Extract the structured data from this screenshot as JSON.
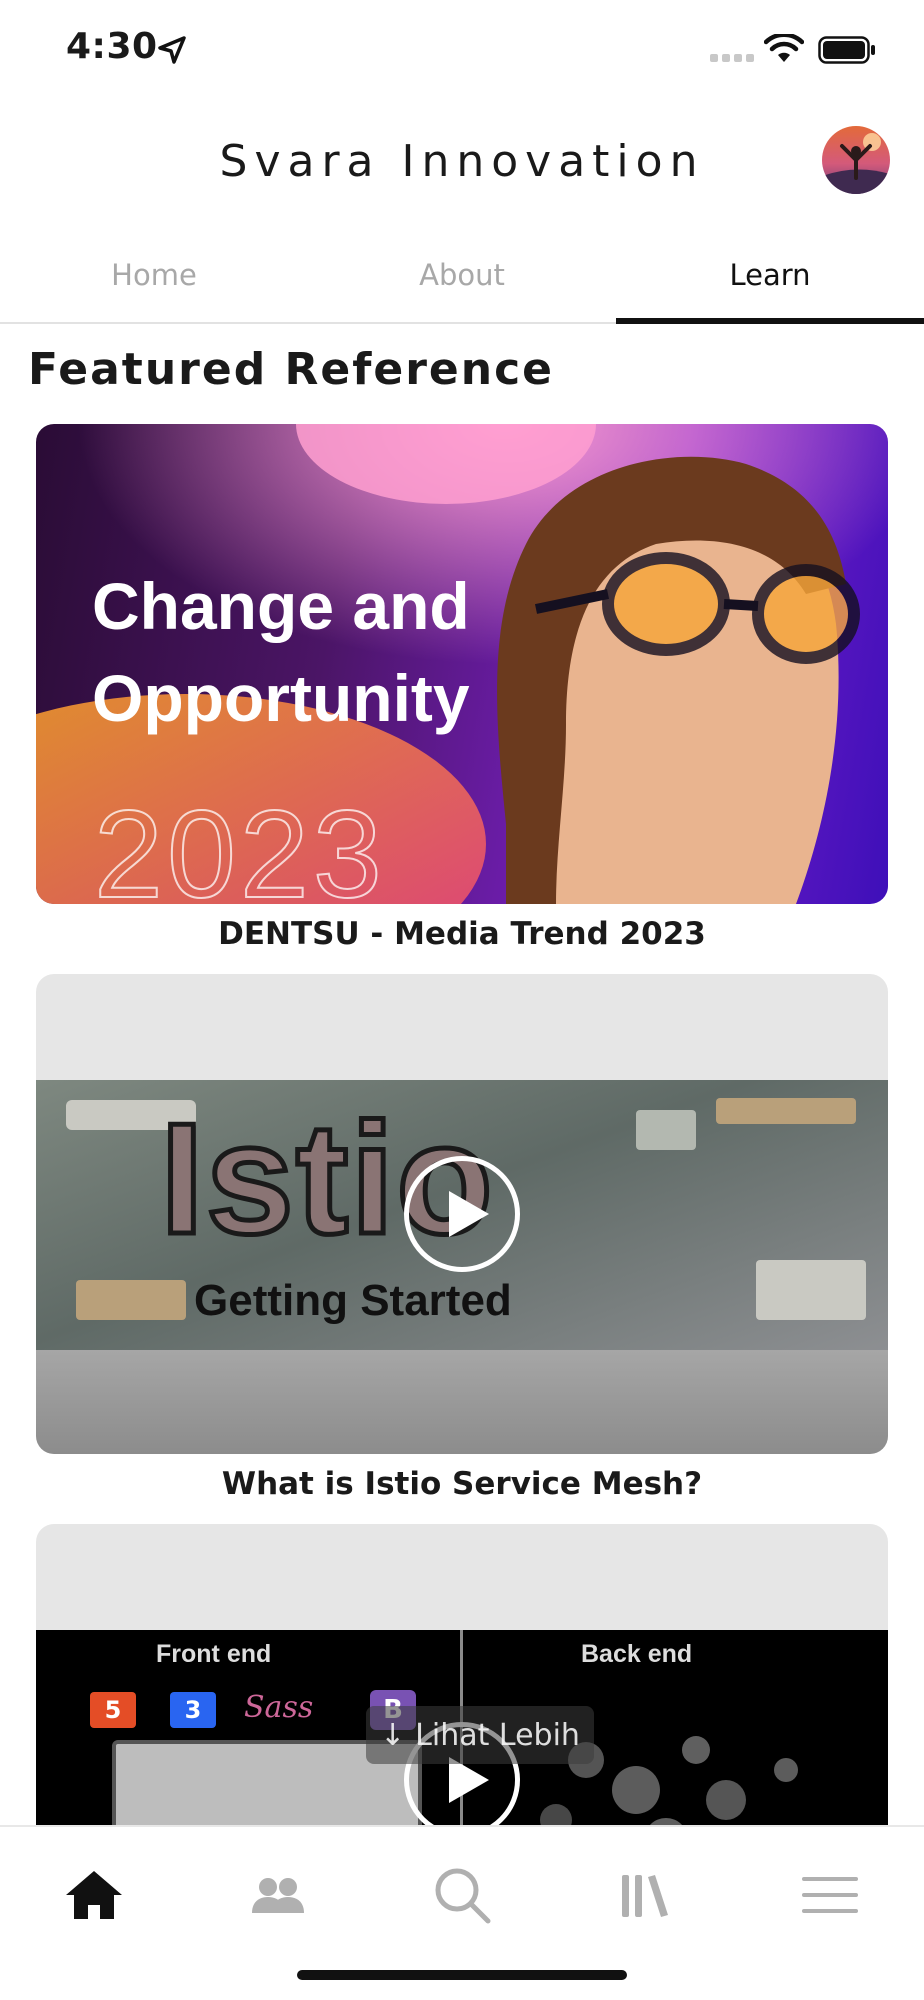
{
  "status_bar": {
    "time": "4:30"
  },
  "header": {
    "title": "Svara Innovation"
  },
  "tabs": [
    {
      "label": "Home",
      "active": false
    },
    {
      "label": "About",
      "active": false
    },
    {
      "label": "Learn",
      "active": true
    }
  ],
  "section": {
    "title": "Featured Reference"
  },
  "cards": [
    {
      "caption": "DENTSU - Media Trend 2023",
      "thumbnail_text": [
        "Change and",
        "Opportunity",
        "2023"
      ],
      "type": "image"
    },
    {
      "caption": "What is Istio Service Mesh?",
      "thumbnail_text": [
        "Istio",
        "Getting Started"
      ],
      "type": "video"
    },
    {
      "caption": "",
      "thumbnail_text": [
        "Front end",
        "Back end",
        "5",
        "3",
        "Sass",
        "B"
      ],
      "type": "video"
    }
  ],
  "see_more": {
    "label": "Lihat Lebih"
  },
  "bottom_nav": [
    {
      "icon": "home-icon",
      "active": true
    },
    {
      "icon": "community-icon",
      "active": false
    },
    {
      "icon": "search-icon",
      "active": false
    },
    {
      "icon": "library-icon",
      "active": false
    },
    {
      "icon": "menu-icon",
      "active": false
    }
  ],
  "colors": {
    "active": "#111111",
    "inactive": "#b0b0b0",
    "accent_purple": "#7a20c8"
  }
}
